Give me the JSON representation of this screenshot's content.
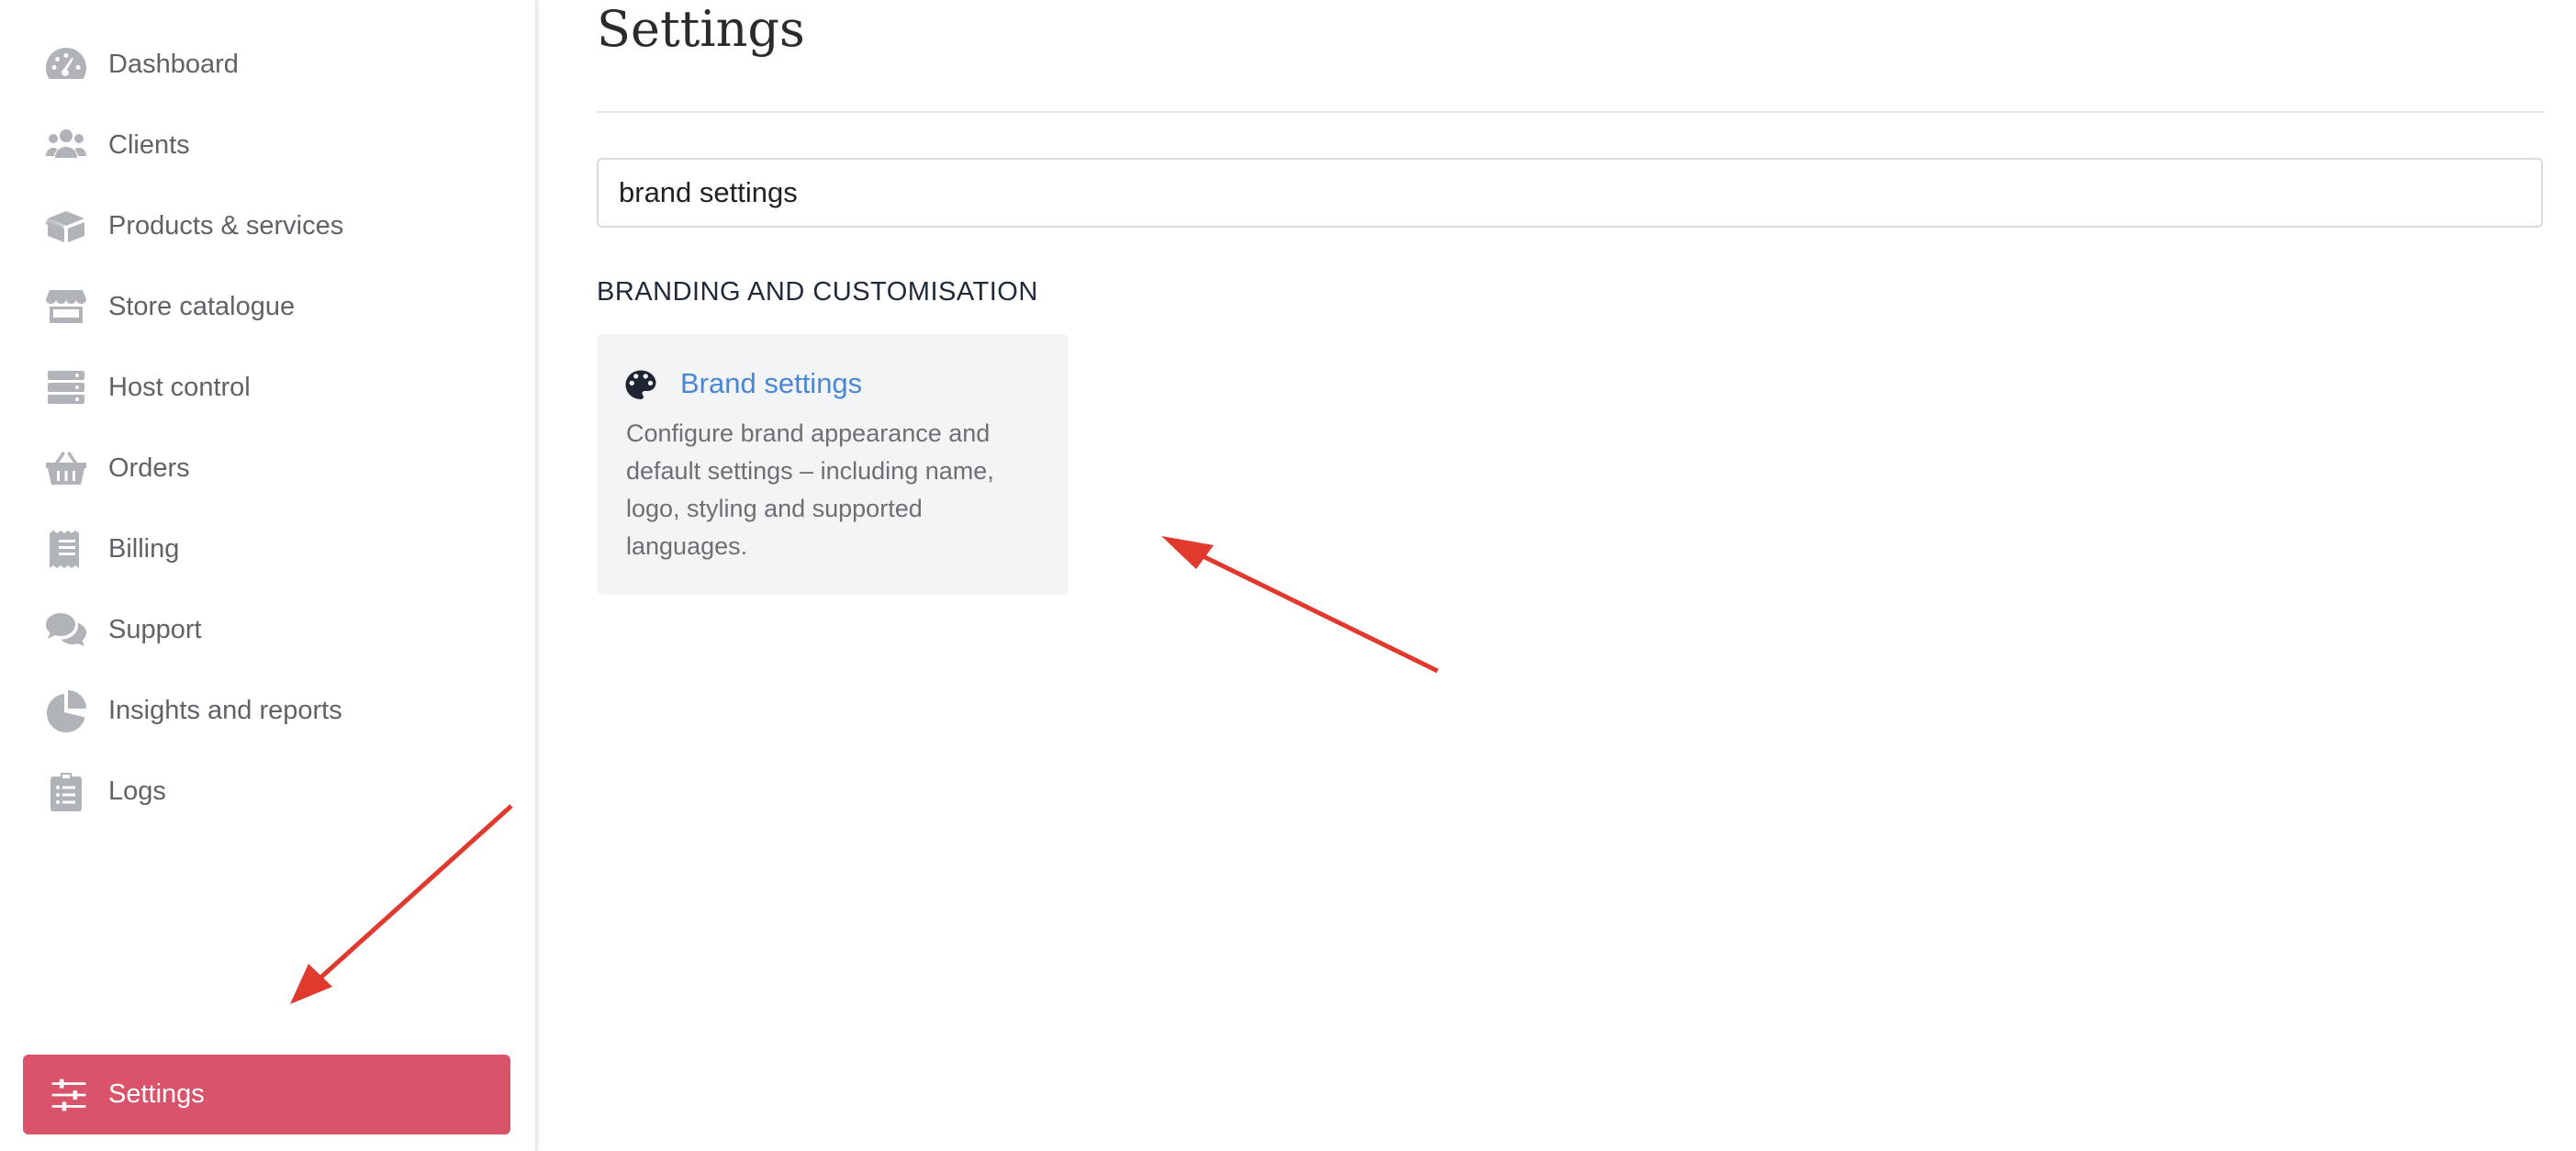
{
  "sidebar": {
    "items": [
      {
        "label": "Dashboard",
        "icon": "dashboard-icon"
      },
      {
        "label": "Clients",
        "icon": "users-icon"
      },
      {
        "label": "Products & services",
        "icon": "box-icon"
      },
      {
        "label": "Store catalogue",
        "icon": "store-icon"
      },
      {
        "label": "Host control",
        "icon": "server-icon"
      },
      {
        "label": "Orders",
        "icon": "basket-icon"
      },
      {
        "label": "Billing",
        "icon": "receipt-icon"
      },
      {
        "label": "Support",
        "icon": "comments-icon"
      },
      {
        "label": "Insights and reports",
        "icon": "pie-chart-icon"
      },
      {
        "label": "Logs",
        "icon": "clipboard-list-icon"
      }
    ],
    "settings": {
      "label": "Settings",
      "icon": "sliders-icon",
      "active": true
    }
  },
  "main": {
    "title": "Settings",
    "search": {
      "value": "brand settings",
      "placeholder": ""
    },
    "section_heading": "BRANDING AND CUSTOMISATION",
    "results": [
      {
        "title": "Brand settings",
        "description": "Configure brand appearance and default settings – including name, logo, styling and supported languages.",
        "icon": "palette-icon"
      }
    ]
  },
  "colors": {
    "accent": "#d9536b",
    "link": "#4a86d6",
    "annotation_arrow": "#e03a2f",
    "sidebar_icon": "#b0b3b8"
  }
}
